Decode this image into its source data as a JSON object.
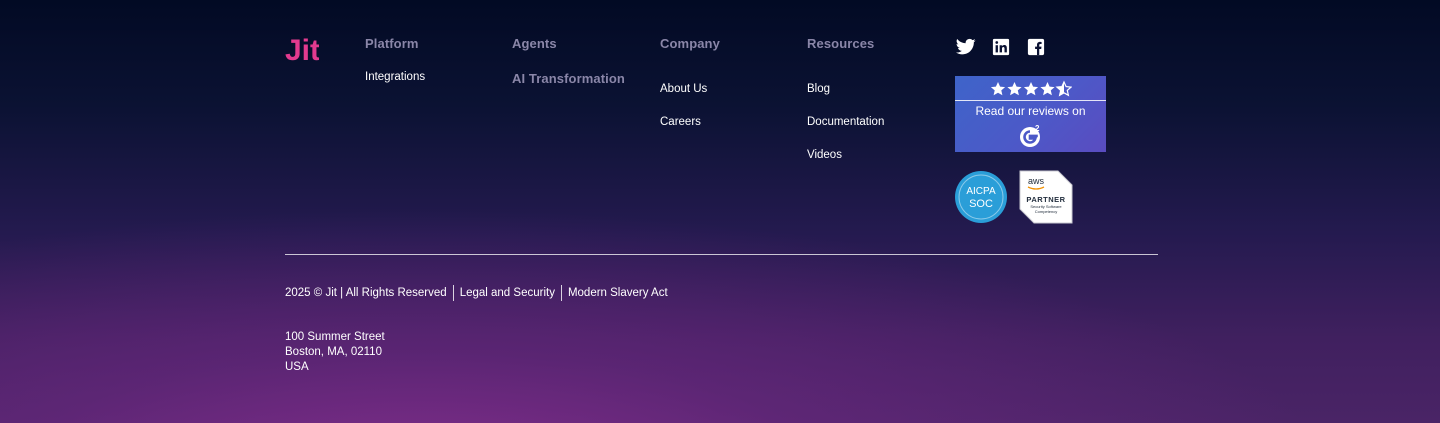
{
  "brand": {
    "logo_text": "Jit",
    "logo_color": "#e23a8f"
  },
  "columns": [
    {
      "heading": "Platform",
      "links": [
        "Integrations"
      ]
    },
    {
      "heading": "Agents",
      "links": [
        "AI Transformation"
      ]
    },
    {
      "heading": "Company",
      "links": [
        "About Us",
        "Careers"
      ]
    },
    {
      "heading": "Resources",
      "links": [
        "Blog",
        "Documentation",
        "Videos"
      ]
    }
  ],
  "social": [
    {
      "icon": "twitter-icon"
    },
    {
      "icon": "linkedin-icon"
    },
    {
      "icon": "facebook-icon"
    }
  ],
  "badges": {
    "g2": {
      "rating_stars": 4.5,
      "text": "Read our reviews on",
      "logo_text": "G2"
    },
    "aicpa": {
      "line1": "AICPA",
      "line2": "SOC"
    },
    "aws": {
      "logo": "aws",
      "line1": "PARTNER",
      "line2": "Security Software",
      "line3": "Competency"
    }
  },
  "legal": {
    "copyright": "2025 © Jit | All Rights Reserved",
    "links": [
      "Legal and Security",
      "Modern Slavery Act"
    ]
  },
  "address": {
    "street": "100 Summer Street",
    "city": "Boston, MA, 02110",
    "country": "USA"
  }
}
